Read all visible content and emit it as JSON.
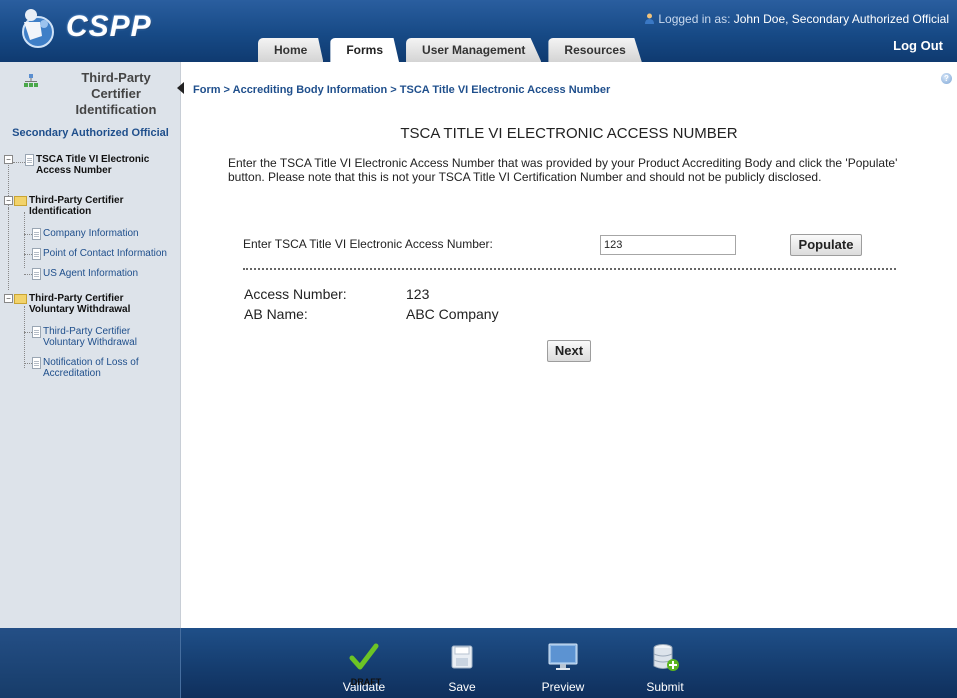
{
  "header": {
    "logo_text": "CSPP",
    "logged_in_label": "Logged in as:",
    "logged_in_user": "John Doe, Secondary Authorized Official",
    "logout_label": "Log Out",
    "tabs": [
      {
        "label": "Home",
        "active": false
      },
      {
        "label": "Forms",
        "active": true
      },
      {
        "label": "User Management",
        "active": false
      },
      {
        "label": "Resources",
        "active": false
      }
    ]
  },
  "sidebar": {
    "title": "Third-Party Certifier Identification",
    "role": "Secondary Authorized Official",
    "tree": [
      {
        "label": "TSCA Title VI Electronic Access Number",
        "type": "doc",
        "bold": true
      },
      {
        "label": "Third-Party Certifier Identification",
        "type": "folder",
        "bold": true
      },
      {
        "label": "Company Information",
        "type": "doc",
        "bold": false
      },
      {
        "label": "Point of Contact Information",
        "type": "doc",
        "bold": false
      },
      {
        "label": "US Agent Information",
        "type": "doc",
        "bold": false
      },
      {
        "label": "Third-Party Certifier Voluntary Withdrawal",
        "type": "folder",
        "bold": true
      },
      {
        "label": "Third-Party Certifier Voluntary Withdrawal",
        "type": "doc",
        "bold": false
      },
      {
        "label": "Notification of Loss of Accreditation",
        "type": "doc",
        "bold": false
      }
    ]
  },
  "main": {
    "breadcrumb": "Form > Accrediting Body Information > TSCA Title VI Electronic Access Number",
    "title": "TSCA TITLE VI ELECTRONIC ACCESS NUMBER",
    "instructions": "Enter the TSCA Title VI Electronic Access Number that was provided by your Product Accrediting Body and click the 'Populate' button. Please note that this is not your TSCA Title VI Certification Number and should not be publicly disclosed.",
    "ean_label": "Enter TSCA Title VI Electronic Access Number:",
    "ean_value": "123",
    "populate_label": "Populate",
    "access_number_label": "Access Number:",
    "access_number_value": "123",
    "ab_name_label": "AB Name:",
    "ab_name_value": "ABC Company",
    "next_label": "Next"
  },
  "footer": {
    "buttons": [
      {
        "label": "Validate",
        "icon": "checkmark-icon"
      },
      {
        "label": "Save",
        "icon": "floppy-disk-icon"
      },
      {
        "label": "Preview",
        "icon": "monitor-icon"
      },
      {
        "label": "Submit",
        "icon": "database-add-icon"
      }
    ],
    "draft_label": "DRAFT"
  },
  "colors": {
    "header_blue": "#174a86",
    "link_blue": "#1f4f8c",
    "sidebar_bg": "#dde3ea",
    "validate_green": "#5bb51f"
  }
}
